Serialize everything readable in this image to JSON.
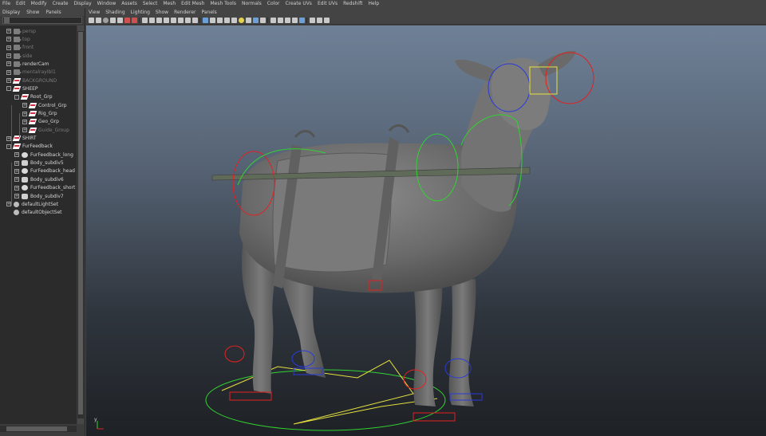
{
  "main_menu": [
    "File",
    "Edit",
    "Modify",
    "Create",
    "Display",
    "Window",
    "Assets",
    "Select",
    "Mesh",
    "Edit Mesh",
    "Mesh Tools",
    "Normals",
    "Color",
    "Create UVs",
    "Edit UVs",
    "Redshift",
    "Help"
  ],
  "outliner": {
    "menu": [
      "Display",
      "Show",
      "Panels"
    ],
    "items": [
      {
        "label": "persp",
        "icon": "camera-icon",
        "dim": true
      },
      {
        "label": "top",
        "icon": "camera-icon",
        "dim": true
      },
      {
        "label": "front",
        "icon": "camera-icon",
        "dim": true
      },
      {
        "label": "side",
        "icon": "camera-icon",
        "dim": true
      },
      {
        "label": "renderCam",
        "icon": "camera-icon",
        "dim": false
      },
      {
        "label": "mentalrayIbl1",
        "icon": "camera-icon",
        "dim": true
      },
      {
        "label": "BACKGROUND",
        "icon": "group-icon",
        "dim": true
      },
      {
        "label": "SHEEP",
        "icon": "group-icon",
        "dim": false
      },
      {
        "label": "Root_Grp",
        "icon": "group-icon",
        "dim": false
      },
      {
        "label": "Control_Grp",
        "icon": "group-icon",
        "dim": false
      },
      {
        "label": "Rig_Grp",
        "icon": "group-icon",
        "dim": false
      },
      {
        "label": "Geo_Grp",
        "icon": "group-icon",
        "dim": false
      },
      {
        "label": "Guide_Group",
        "icon": "group-icon",
        "dim": true
      },
      {
        "label": "SHIRT",
        "icon": "group-icon",
        "dim": false
      },
      {
        "label": "FurFeedback",
        "icon": "group-icon",
        "dim": false
      },
      {
        "label": "FurFeedback_long",
        "icon": "fur-icon",
        "dim": false
      },
      {
        "label": "Body_subdiv5",
        "icon": "mesh-icon",
        "dim": false
      },
      {
        "label": "FurFeedback_head",
        "icon": "fur-icon",
        "dim": false
      },
      {
        "label": "Body_subdiv6",
        "icon": "mesh-icon",
        "dim": false
      },
      {
        "label": "FurFeedback_short",
        "icon": "fur-icon",
        "dim": false
      },
      {
        "label": "Body_subdiv7",
        "icon": "mesh-icon",
        "dim": false
      },
      {
        "label": "defaultLightSet",
        "icon": "set-icon",
        "dim": false
      },
      {
        "label": "defaultObjectSet",
        "icon": "set-icon",
        "dim": false
      }
    ]
  },
  "panel_menu": [
    "View",
    "Shading",
    "Lighting",
    "Show",
    "Renderer",
    "Panels"
  ],
  "axis_gizmo": "y",
  "colors": {
    "mesh": "#6e6e6e",
    "curve_red": "#e32020",
    "curve_green": "#32d232",
    "curve_blue": "#2a3ad8",
    "curve_yellow": "#e6e040"
  }
}
